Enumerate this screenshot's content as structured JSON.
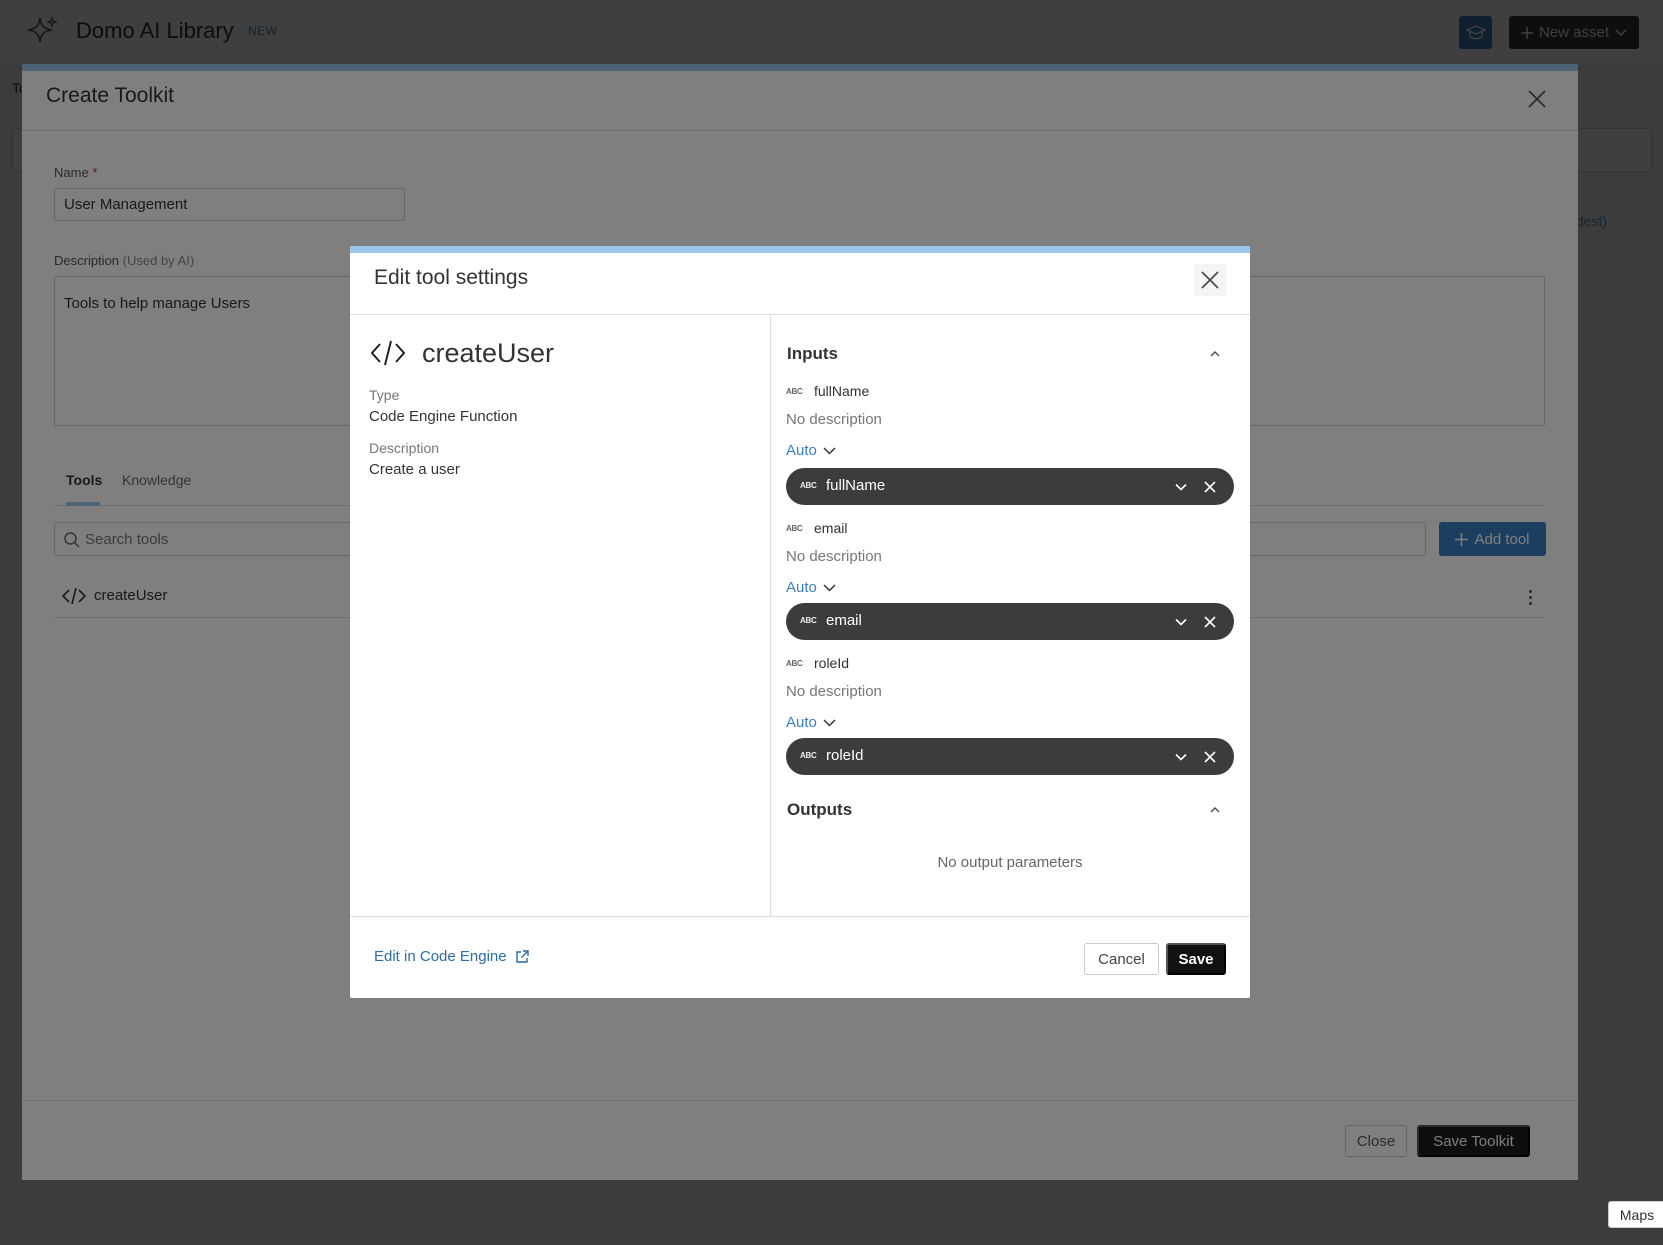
{
  "app": {
    "title": "Domo AI Library",
    "badge": "NEW",
    "new_asset_label": "New asset",
    "tab_stub": "To",
    "sort_stub": "oldest)"
  },
  "toolkit_modal": {
    "title": "Create Toolkit",
    "name_label": "Name",
    "name_required_mark": "*",
    "name_value": "User Management",
    "description_label": "Description",
    "description_hint": "(Used by AI)",
    "description_value": "Tools to help manage Users",
    "tabs": [
      {
        "label": "Tools",
        "active": true
      },
      {
        "label": "Knowledge",
        "active": false
      }
    ],
    "search_placeholder": "Search tools",
    "add_tool_label": "Add tool",
    "tools": [
      {
        "label": "createUser",
        "icon": "code-icon"
      }
    ],
    "close_label": "Close",
    "save_label": "Save Toolkit"
  },
  "edit_modal": {
    "title": "Edit tool settings",
    "tool_name": "createUser",
    "type_label": "Type",
    "type_value": "Code Engine Function",
    "description_label": "Description",
    "description_value": "Create a user",
    "inputs_title": "Inputs",
    "inputs": [
      {
        "type_badge": "ABC",
        "name": "fullName",
        "description": "No description",
        "mode": "Auto",
        "mapped_value": "fullName"
      },
      {
        "type_badge": "ABC",
        "name": "email",
        "description": "No description",
        "mode": "Auto",
        "mapped_value": "email"
      },
      {
        "type_badge": "ABC",
        "name": "roleId",
        "description": "No description",
        "mode": "Auto",
        "mapped_value": "roleId"
      }
    ],
    "outputs_title": "Outputs",
    "no_outputs": "No output parameters",
    "edit_link": "Edit in Code Engine",
    "cancel_label": "Cancel",
    "save_label": "Save"
  },
  "tooltip": {
    "label": "Maps"
  },
  "colors": {
    "accent_blue": "#3b7fbf",
    "modal_accent": "#9cc7ea",
    "pill_bg": "#3c3c3c",
    "primary_button": "#111111"
  }
}
